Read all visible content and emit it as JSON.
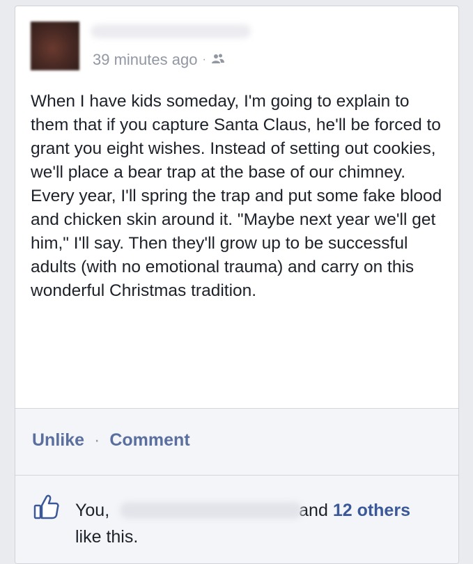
{
  "post": {
    "timestamp": "39 minutes ago",
    "separator": "·",
    "audience_icon": "friends-icon",
    "text": "When I have kids someday, I'm going to explain to them that if you capture Santa Claus, he'll be forced to grant you eight wishes. Instead of setting out cookies, we'll place a bear trap at the base of our chimney. Every year, I'll spring the trap and put some fake blood and chicken skin around it. \"Maybe next year we'll get him,\" I'll say. Then they'll grow up to be successful adults (with no emotional trauma) and carry on this wonderful Christmas tradition."
  },
  "actions": {
    "unlike": "Unlike",
    "separator": "·",
    "comment": "Comment"
  },
  "likes": {
    "icon": "thumbs-up-icon",
    "you": "You,",
    "and": "and",
    "others": "12 others",
    "tail": "like this."
  },
  "colors": {
    "link": "#3b5998",
    "muted": "#9197a3",
    "action": "#5b6f9e"
  }
}
